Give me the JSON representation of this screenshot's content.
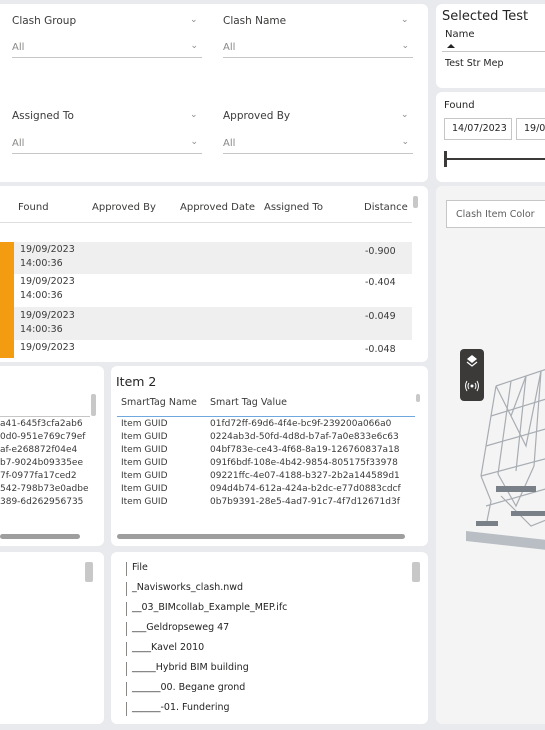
{
  "slicers": {
    "clash_group": {
      "label": "Clash Group",
      "value": "All"
    },
    "clash_name": {
      "label": "Clash Name",
      "value": "All"
    },
    "assigned_to": {
      "label": "Assigned To",
      "value": "All"
    },
    "approved_by": {
      "label": "Approved By",
      "value": "All"
    }
  },
  "selected_test": {
    "title": "Selected Test",
    "column": "Name",
    "value": "Test Str Mep"
  },
  "found": {
    "label": "Found",
    "start": "14/07/2023",
    "end": "19/0"
  },
  "clash_table": {
    "headers": [
      "Found",
      "Approved By",
      "Approved Date",
      "Assigned To",
      "Distance"
    ],
    "rows": [
      {
        "found_date": "19/09/2023",
        "found_time": "14:00:36",
        "distance": "-0.900"
      },
      {
        "found_date": "19/09/2023",
        "found_time": "14:00:36",
        "distance": "-0.404"
      },
      {
        "found_date": "19/09/2023",
        "found_time": "14:00:36",
        "distance": "-0.049"
      },
      {
        "found_date": "19/09/2023",
        "found_time": "",
        "distance": "-0.048"
      }
    ]
  },
  "viewer": {
    "color_label": "Clash Item Color"
  },
  "item1": {
    "values": [
      "a41-645f3cfa2ab6",
      "0d0-951e769c79ef",
      "af-e268872f04e4",
      "b7-9024b09335ee",
      "7f-0977fa17ced2",
      "542-798b73e0adbe",
      "389-6d262956735"
    ]
  },
  "item2": {
    "title": "Item 2",
    "headers": [
      "SmartTag Name",
      "Smart Tag Value"
    ],
    "rows": [
      {
        "name": "Item GUID",
        "value": "01fd72ff-69d6-4f4e-bc9f-239200a066a0"
      },
      {
        "name": "Item GUID",
        "value": "0224ab3d-50fd-4d8d-b7af-7a0e833e6c63"
      },
      {
        "name": "Item GUID",
        "value": "04bf783e-ce43-4f68-8a19-126760837a18"
      },
      {
        "name": "Item GUID",
        "value": "091f6bdf-108e-4b42-9854-805175f33978"
      },
      {
        "name": "Item GUID",
        "value": "09221ffc-4e07-4188-b327-2b2a144589d1"
      },
      {
        "name": "Item GUID",
        "value": "094d4b74-612a-424a-b2dc-e77d0883cdcf"
      },
      {
        "name": "Item GUID",
        "value": "0b7b9391-28e5-4ad7-91c7-4f7d12671d3f"
      }
    ]
  },
  "file_tree": {
    "items": [
      "File",
      "_Navisworks_clash.nwd",
      "__03_BIMcollab_Example_MEP.ifc",
      "___Geldropseweg 47",
      "____Kavel 2010",
      "_____Hybrid BIM building",
      "______00. Begane grond",
      "______-01. Fundering"
    ]
  }
}
